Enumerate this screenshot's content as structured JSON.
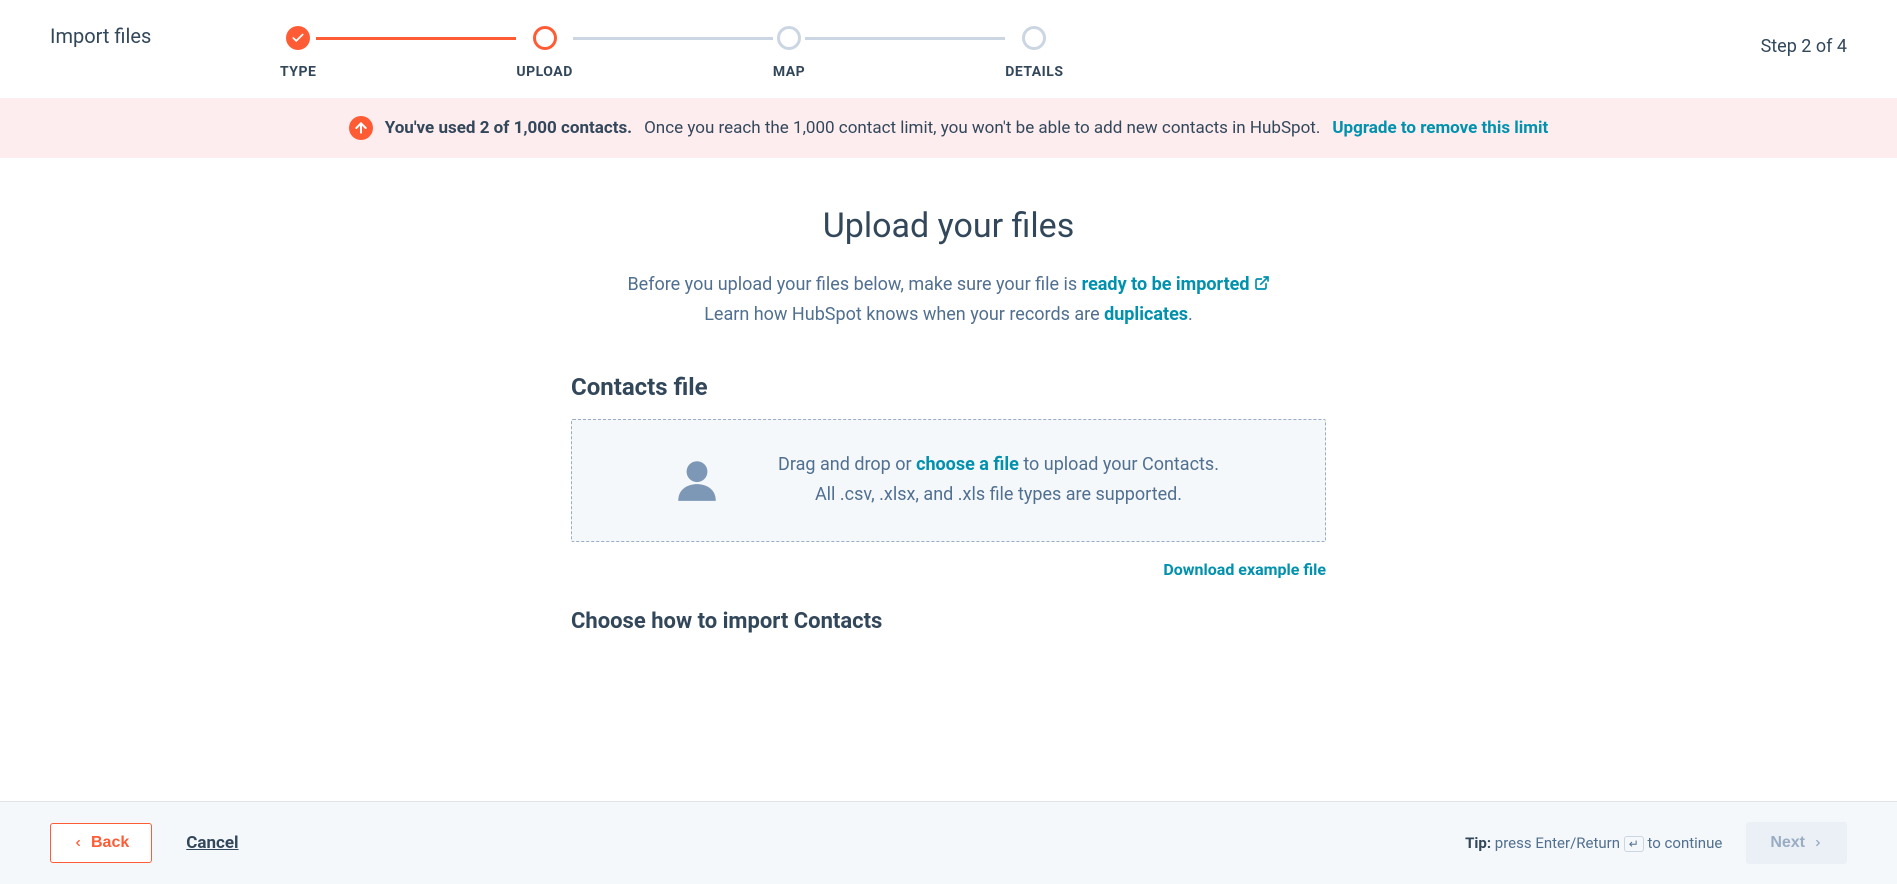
{
  "header": {
    "title": "Import files",
    "step_indicator": "Step 2 of 4"
  },
  "progress": {
    "steps": [
      "TYPE",
      "UPLOAD",
      "MAP",
      "DETAILS"
    ]
  },
  "banner": {
    "bold": "You've used 2 of 1,000 contacts.",
    "text": "Once you reach the 1,000 contact limit, you won't be able to add new contacts in HubSpot.",
    "link": "Upgrade to remove this limit"
  },
  "main": {
    "title": "Upload your files",
    "sub1_pre": "Before you upload your files below, make sure your file is ",
    "sub1_link": "ready to be imported",
    "sub2_pre": "Learn how HubSpot knows when your records are ",
    "sub2_link": "duplicates",
    "sub2_post": ".",
    "section_heading": "Contacts file",
    "dropzone_pre": "Drag and drop or ",
    "dropzone_link": "choose a file",
    "dropzone_post": " to upload your Contacts.",
    "dropzone_line2": "All .csv, .xlsx, and .xls file types are supported.",
    "download_link": "Download example file",
    "import_heading": "Choose how to import Contacts"
  },
  "footer": {
    "back": "Back",
    "cancel": "Cancel",
    "tip_bold": "Tip:",
    "tip_text_pre": " press Enter/Return ",
    "tip_text_post": " to continue",
    "next": "Next"
  }
}
